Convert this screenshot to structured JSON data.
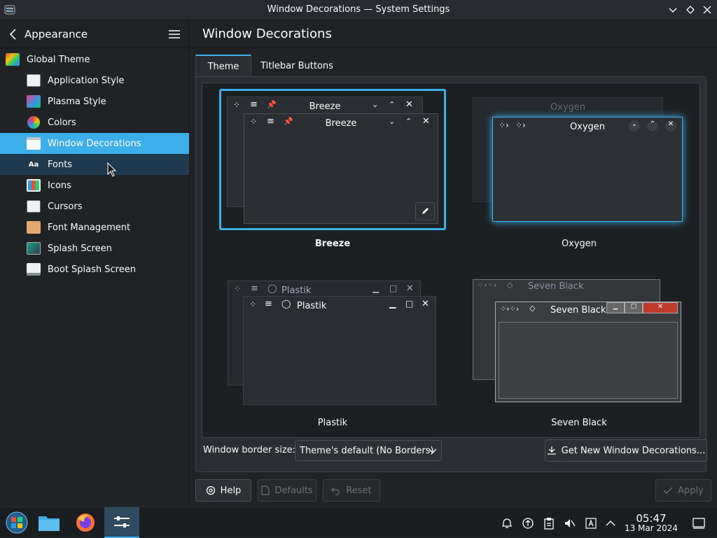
{
  "window": {
    "title": "Window Decorations — System Settings"
  },
  "sidebar": {
    "header_title": "Appearance",
    "items": [
      {
        "label": "Global Theme"
      },
      {
        "label": "Application Style"
      },
      {
        "label": "Plasma Style"
      },
      {
        "label": "Colors"
      },
      {
        "label": "Window Decorations"
      },
      {
        "label": "Fonts"
      },
      {
        "label": "Icons"
      },
      {
        "label": "Cursors"
      },
      {
        "label": "Font Management"
      },
      {
        "label": "Splash Screen"
      },
      {
        "label": "Boot Splash Screen"
      }
    ]
  },
  "main": {
    "title": "Window Decorations",
    "tabs": [
      {
        "label": "Theme"
      },
      {
        "label": "Titlebar Buttons"
      }
    ],
    "decorations": [
      {
        "name": "Breeze",
        "selected": true
      },
      {
        "name": "Oxygen",
        "selected": false
      },
      {
        "name": "Plastik",
        "selected": false
      },
      {
        "name": "Seven Black",
        "selected": false
      }
    ],
    "border_size_label": "Window border size:",
    "border_size_value": "Theme's default (No Borders)",
    "get_new_label": "Get New Window Decorations...",
    "buttons": {
      "help": "Help",
      "defaults": "Defaults",
      "reset": "Reset",
      "apply": "Apply"
    }
  },
  "taskbar": {
    "time": "05:47",
    "date": "13 Mar 2024"
  },
  "colors": {
    "accent": "#3daee9",
    "background": "#202326",
    "panel": "#2a2e32"
  }
}
